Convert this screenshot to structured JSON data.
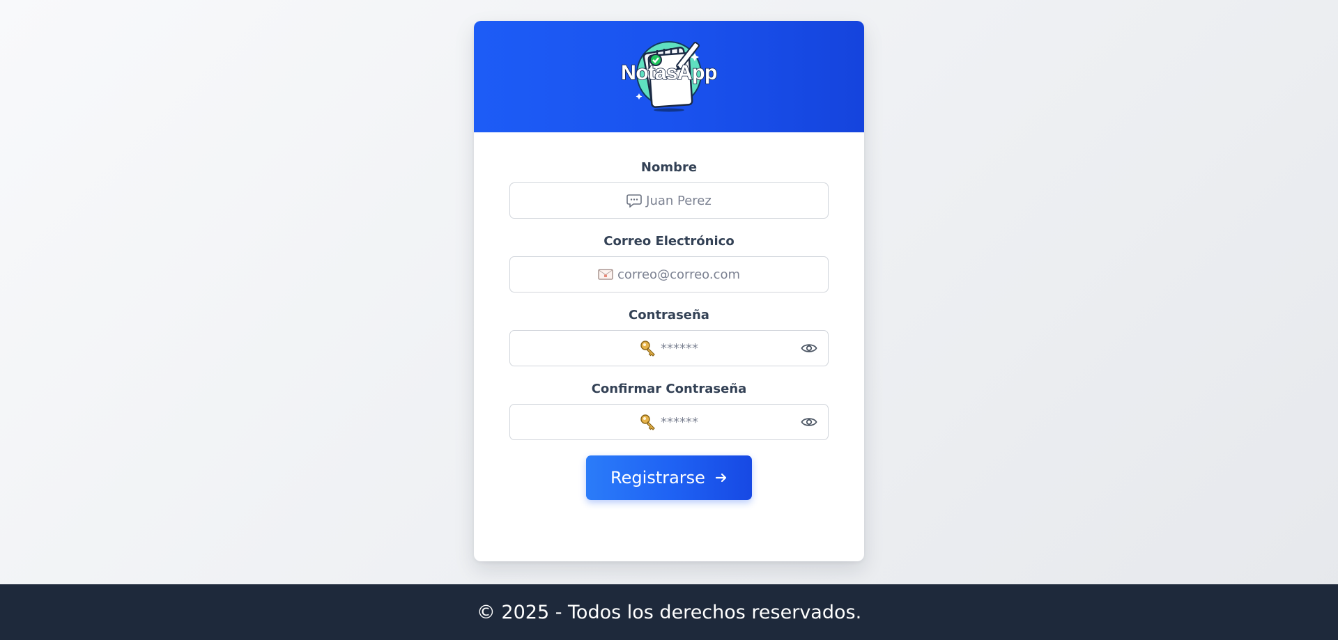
{
  "brand": {
    "logo_text": "NotasApp",
    "header_gradient": [
      "#1d5cf6",
      "#1544dd"
    ]
  },
  "form": {
    "fields": [
      {
        "label": "Nombre",
        "placeholder": "Juan Perez",
        "icon": "speech-bubble-icon",
        "type": "text"
      },
      {
        "label": "Correo Electrónico",
        "placeholder": "correo@correo.com",
        "icon": "envelope-icon",
        "type": "email"
      },
      {
        "label": "Contraseña",
        "placeholder": "******",
        "icon": "key-icon",
        "type": "password",
        "toggle_icon": "eye-icon"
      },
      {
        "label": "Confirmar Contraseña",
        "placeholder": "******",
        "icon": "key-icon",
        "type": "password",
        "toggle_icon": "eye-icon"
      }
    ],
    "submit_label": "Registrarse",
    "submit_icon": "arrow-right-icon",
    "submit_color": "#1f63f4"
  },
  "footer": {
    "text": "© 2025 - Todos los derechos reservados.",
    "background": "#1e293b"
  }
}
